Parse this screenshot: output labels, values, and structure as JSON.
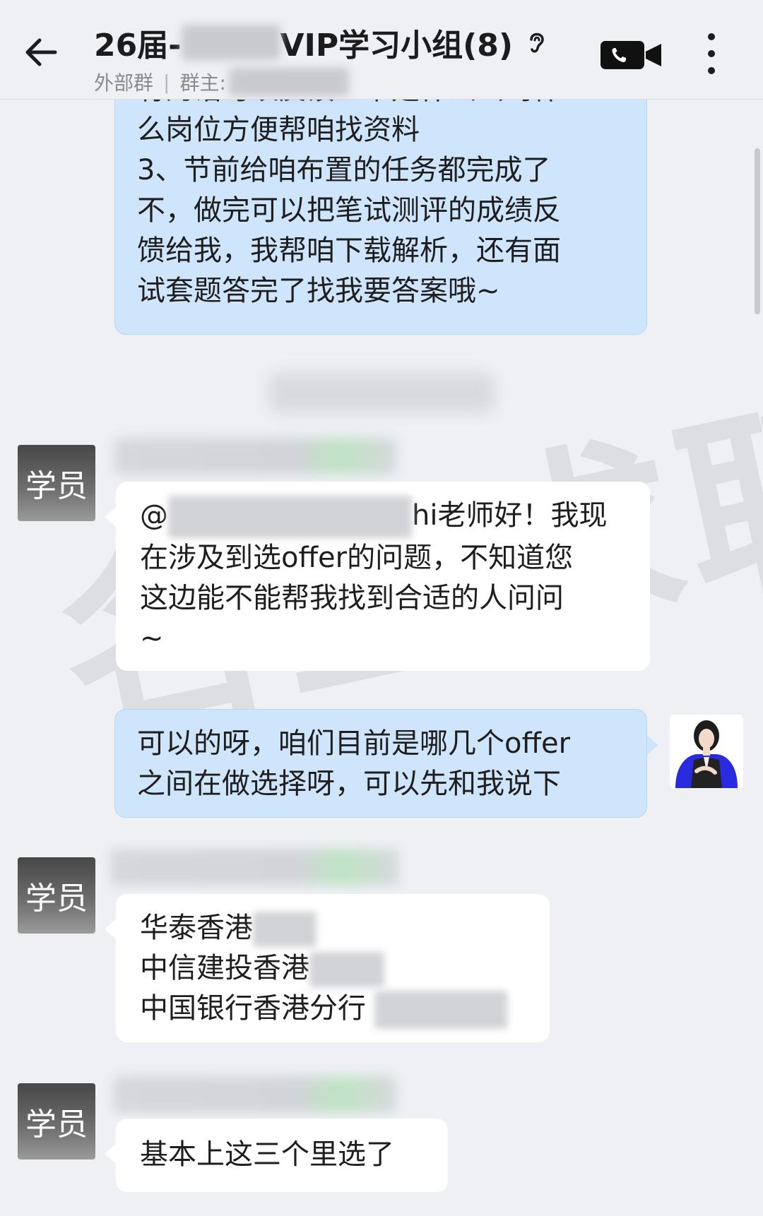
{
  "header": {
    "title_prefix": "26届-",
    "title_suffix": "VIP学习小组(8)",
    "subtitle_tag": "外部群",
    "subtitle_separator": "|",
    "owner_label": "群主:"
  },
  "watermark": "名企求职",
  "messages": [
    {
      "sender": "teacher",
      "lines": [
        "有的话可以反馈一下是什么公司什",
        "么岗位方便帮咱找资料",
        "3、节前给咱布置的任务都完成了",
        "不，做完可以把笔试测评的成绩反",
        "馈给我，我帮咱下载解析，还有面",
        "试套题答完了找我要答案哦~"
      ]
    },
    {
      "sender": "student",
      "avatar_label": "学员",
      "prefix": "@",
      "lines": [
        "hi老师好！我现",
        "在涉及到选offer的问题，不知道您",
        "这边能不能帮我找到合适的人问问",
        "~"
      ]
    },
    {
      "sender": "teacher",
      "lines": [
        "可以的呀，咱们目前是哪几个offer",
        "之间在做选择呀，可以先和我说下"
      ]
    },
    {
      "sender": "student",
      "avatar_label": "学员",
      "lines": [
        "华泰香港",
        "中信建投香港",
        "中国银行香港分行"
      ]
    },
    {
      "sender": "student",
      "avatar_label": "学员",
      "lines": [
        "基本上这三个里选了"
      ]
    }
  ],
  "colors": {
    "background": "#eef0f4",
    "teacher_bubble": "#cfe5fb",
    "student_bubble": "#ffffff",
    "teacher_avatar_accent": "#2a2ae0"
  }
}
